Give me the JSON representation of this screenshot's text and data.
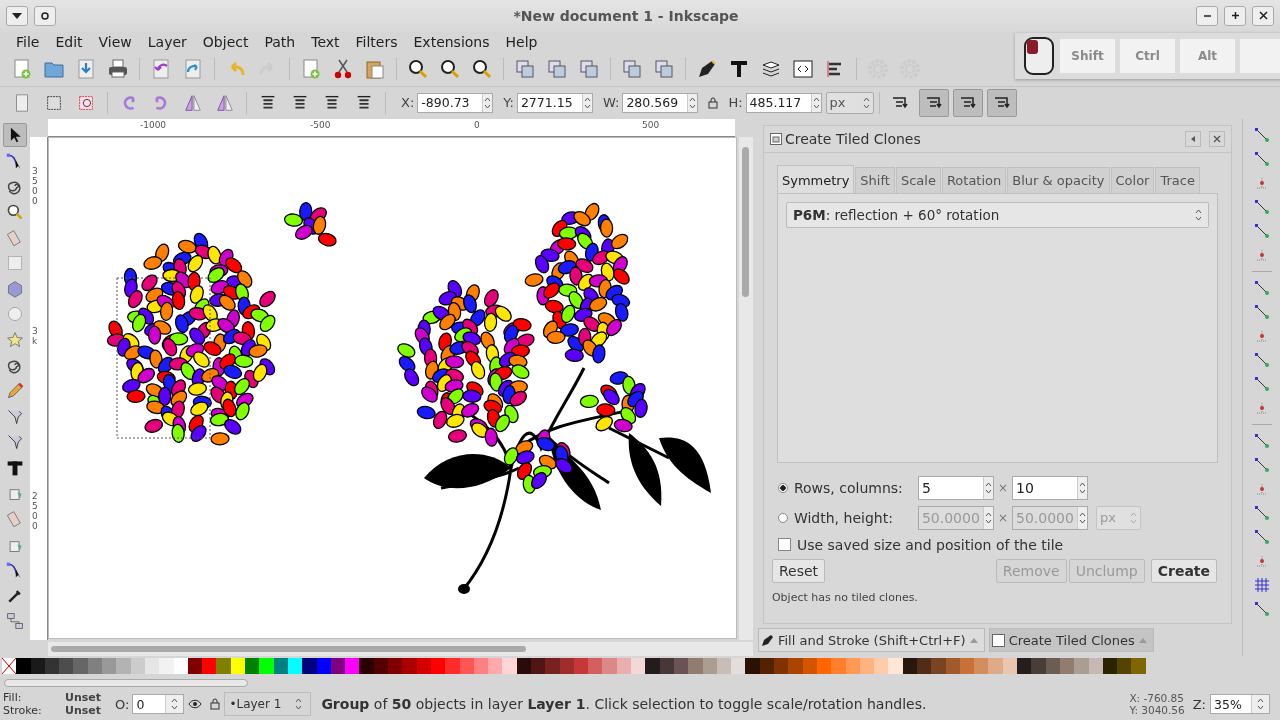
{
  "window": {
    "title": "*New document 1 - Inkscape"
  },
  "menu": [
    "File",
    "Edit",
    "View",
    "Layer",
    "Object",
    "Path",
    "Text",
    "Filters",
    "Extensions",
    "Help"
  ],
  "key_overlay": [
    "Shift",
    "Ctrl",
    "Alt"
  ],
  "selector_toolbar": {
    "fields": [
      {
        "label": "X:",
        "value": "-890.73"
      },
      {
        "label": "Y:",
        "value": "2771.15"
      },
      {
        "label": "W:",
        "value": "280.569"
      },
      {
        "label": "H:",
        "value": "485.117"
      }
    ],
    "unit": "px",
    "toggles": [
      {
        "pressed": false
      },
      {
        "pressed": true
      },
      {
        "pressed": true
      },
      {
        "pressed": true
      }
    ]
  },
  "tools": [
    {
      "selected": true
    },
    {
      "selected": false
    },
    {
      "selected": false
    },
    {
      "selected": false
    },
    {
      "selected": false
    },
    {
      "selected": false
    },
    {
      "selected": false
    },
    {
      "selected": false
    },
    {
      "selected": false
    },
    {
      "selected": false
    },
    {
      "selected": false
    },
    {
      "selected": false
    },
    {
      "selected": false
    },
    {
      "selected": false
    },
    {
      "selected": false
    },
    {
      "selected": false
    },
    {
      "selected": false
    },
    {
      "selected": false
    },
    {
      "selected": false
    },
    {
      "selected": false
    }
  ],
  "rulers": {
    "horizontal": [
      "-1000",
      "-500",
      "0",
      "500"
    ],
    "vertical": [
      "3500",
      "3k",
      "2500"
    ]
  },
  "dialog": {
    "title": "Create Tiled Clones",
    "tabs": [
      {
        "label": "Symmetry",
        "selected": true
      },
      {
        "label": "Shift",
        "selected": false
      },
      {
        "label": "Scale",
        "selected": false
      },
      {
        "label": "Rotation",
        "selected": false
      },
      {
        "label": "Blur & opacity",
        "selected": false
      },
      {
        "label": "Color",
        "selected": false
      },
      {
        "label": "Trace",
        "selected": false
      }
    ],
    "symmetry": "**P6M**: reflection + 60° rotation",
    "size_options": [
      {
        "label": "Rows, columns:",
        "selected": true,
        "disabled": false,
        "values": [
          "5",
          "10"
        ],
        "separator": "×"
      },
      {
        "label": "Width, height:",
        "selected": false,
        "disabled": true,
        "values": [
          "50.0000",
          "50.0000"
        ],
        "separator": "×",
        "unit": "px"
      }
    ],
    "checkbox": {
      "label": "Use saved size and position of the tile",
      "checked": false
    },
    "buttons": [
      {
        "label": "Reset",
        "disabled": false,
        "kind": "normal"
      },
      {
        "label": "Remove",
        "disabled": true,
        "kind": "normal"
      },
      {
        "label": "Unclump",
        "disabled": true,
        "kind": "normal"
      },
      {
        "label": "Create",
        "disabled": false,
        "kind": "primary"
      }
    ],
    "status": "Object has no tiled clones."
  },
  "dock_tabs": [
    {
      "label": "Fill and Stroke (Shift+Ctrl+F)",
      "selected": false
    },
    {
      "label": "Create Tiled Clones",
      "selected": true
    }
  ],
  "status_bar": {
    "fill_label": "Fill:",
    "fill_value": "Unset",
    "stroke_label": "Stroke:",
    "stroke_value": "Unset",
    "opacity_label": "O:",
    "opacity": "0",
    "layer": "•Layer 1",
    "message": "**Group** of **50** objects in layer **Layer 1**. Click selection to toggle scale/rotation handles.",
    "x": "X: -760.85",
    "y": "Y: 3040.56",
    "zoom_label": "Z:",
    "zoom": "35%"
  }
}
